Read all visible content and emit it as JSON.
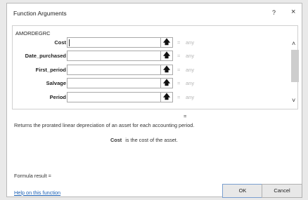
{
  "dialog": {
    "title": "Function Arguments",
    "help_glyph": "?",
    "close_glyph": "×"
  },
  "function_name": "AMORDEGRC",
  "arguments": [
    {
      "label": "Cost",
      "value": "",
      "eq": "=",
      "result": "any"
    },
    {
      "label": "Date_purchased",
      "value": "",
      "eq": "=",
      "result": "any"
    },
    {
      "label": "First_period",
      "value": "",
      "eq": "=",
      "result": "any"
    },
    {
      "label": "Salvage",
      "value": "",
      "eq": "=",
      "result": "any"
    },
    {
      "label": "Period",
      "value": "",
      "eq": "=",
      "result": "any"
    }
  ],
  "ref_glyph": "🡅",
  "scroll": {
    "up": "˄",
    "down": "˅"
  },
  "result_eq": "=",
  "description": "Returns the prorated linear depreciation of an asset for each accounting period.",
  "arg_description": {
    "name": "Cost",
    "text": "is the cost of the asset."
  },
  "formula_result": "Formula result =",
  "help_link": "Help on this function",
  "buttons": {
    "ok": "OK",
    "cancel": "Cancel"
  },
  "colors": {
    "link": "#1a5fb4",
    "placeholder": "#b5b5b5"
  }
}
